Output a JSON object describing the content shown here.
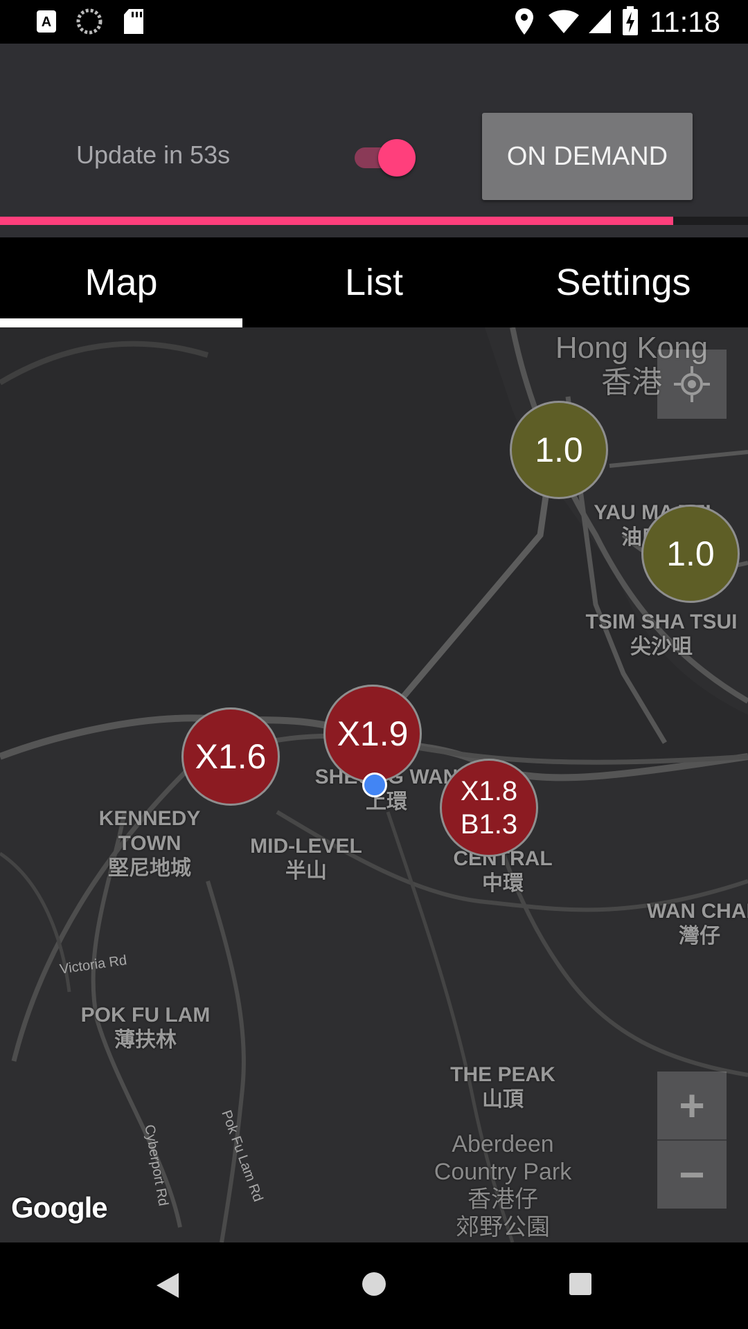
{
  "status_bar": {
    "time": "11:18",
    "icons": [
      "a-notification-icon",
      "sync-icon",
      "sd-card-icon",
      "location-icon",
      "wifi-icon",
      "signal-icon",
      "battery-charging-icon"
    ]
  },
  "controls": {
    "update_text": "Update in 53s",
    "auto_update_on": true,
    "on_demand_label": "ON DEMAND",
    "progress": 0.9,
    "accent_color": "#ff3f7c"
  },
  "tabs": {
    "items": [
      {
        "label": "Map",
        "selected": true
      },
      {
        "label": "List",
        "selected": false
      },
      {
        "label": "Settings",
        "selected": false
      }
    ]
  },
  "map": {
    "area_labels": {
      "hong_kong": "Hong Kong\n香港",
      "yau_ma_tei": "YAU MA TEI\n油麻地",
      "tsim_sha_tsui": "TSIM SHA TSUI\n尖沙咀",
      "kennedy_town": "KENNEDY\nTOWN\n堅尼地城",
      "mid_level": "MID-LEVEL\n半山",
      "sheung_wan": "SHEUNG WAN\n上環",
      "central": "CENTRAL\n中環",
      "wan_chai": "WAN CHAI\n灣仔",
      "pok_fu_lam": "POK FU LAM\n薄扶林",
      "the_peak": "THE PEAK\n山頂",
      "aberdeen_park": "Aberdeen\nCountry Park\n香港仔\n郊野公園"
    },
    "road_labels": {
      "victoria_rd": "Victoria Rd",
      "cyberport_rd": "Cyberport Rd",
      "pok_fu_lam_rd": "Pok Fu Lam Rd"
    },
    "markers": [
      {
        "id": "marker-x16",
        "label": "X1.6",
        "color": "#8c1b22"
      },
      {
        "id": "marker-x19",
        "label": "X1.9",
        "color": "#8c1b22"
      },
      {
        "id": "marker-central",
        "label": "X1.8\nB1.3",
        "color": "#8c1b22"
      },
      {
        "id": "marker-hk",
        "label": "1.0",
        "color": "#5e5e26"
      },
      {
        "id": "marker-ymt",
        "label": "1.0",
        "color": "#5e5e26"
      }
    ],
    "zoom_in": "+",
    "zoom_out": "−",
    "attribution": "Google"
  }
}
